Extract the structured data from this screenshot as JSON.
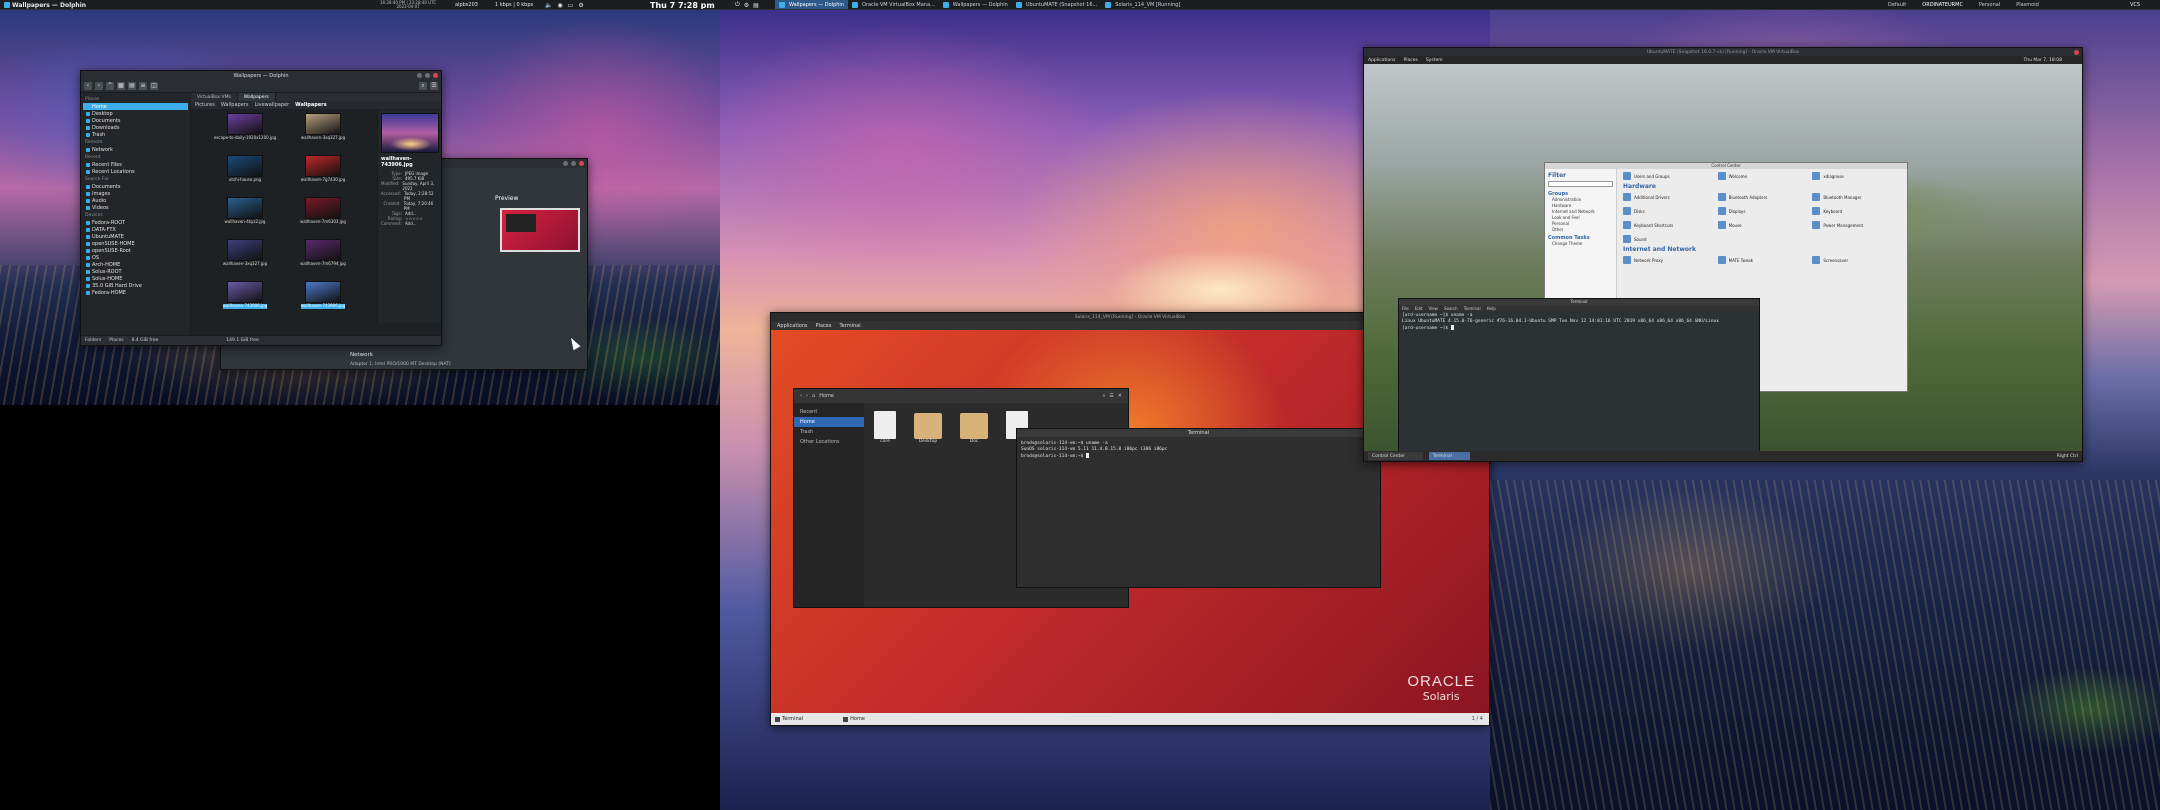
{
  "top_panel": {
    "left_title": "Wallpapers — Dolphin",
    "sys_stats_line1": "16:28:40 PM | 23:28:40 UTC",
    "sys_stats_line2": "2022-04-07",
    "net_stats": "1 kbps | 0 kbps",
    "username": "alpbs203",
    "clock": "Thu 7  7:28 pm",
    "tasks": [
      {
        "label": "Wallpapers — Dolphin",
        "active": true
      },
      {
        "label": "Oracle VM VirtualBox Mana...",
        "active": false
      },
      {
        "label": "Wallpapers — Dolphin",
        "active": false
      },
      {
        "label": "UbuntuMATE (Snapshot 16...",
        "active": false
      },
      {
        "label": "Solaris_114_VM [Running]",
        "active": false
      }
    ],
    "activities": [
      "Default",
      "ORDINATEURMC",
      "Personal",
      "Plasmoid"
    ],
    "active_activity": 1,
    "right_text": "VCS"
  },
  "dolphin": {
    "title": "Wallpapers — Dolphin",
    "tabs": [
      "VirtualBox VMs",
      "Wallpapers"
    ],
    "breadcrumbs": [
      "Pictures",
      "Wallpapers",
      "Livewallpaper",
      "Wallpapers"
    ],
    "places_heading": "Places",
    "places": [
      "Home",
      "Desktop",
      "Documents",
      "Downloads",
      "Trash"
    ],
    "remote_heading": "Remote",
    "remote": [
      "Network"
    ],
    "recent_heading": "Recent",
    "recent": [
      "Recent Files",
      "Recent Locations"
    ],
    "search_heading": "Search For",
    "search": [
      "Documents",
      "Images",
      "Audio",
      "Videos"
    ],
    "devices_heading": "Devices",
    "devices": [
      "Fedora-ROOT",
      "DATA-FTX",
      "UbuntuMATE",
      "openSUSE-HOME",
      "openSUSE-Root",
      "OS",
      "Arch-HOME",
      "Solus-ROOT",
      "Solus-HOME",
      "35.0 GiB Hard Drive",
      "Fedora-HOME"
    ],
    "files": [
      {
        "name": "escape-to-daily-1920x1200.jpg",
        "color": "#6b3fa0"
      },
      {
        "name": "wallhaven-3xq327.jpg",
        "color": "#b5a080"
      },
      {
        "name": "utshi-house.png",
        "color": "#1c4a7a"
      },
      {
        "name": "wallhaven-7g7430.jpg",
        "color": "#c0282a"
      },
      {
        "name": "wallhaven-4kyz2.jpg",
        "color": "#2b5f8e"
      },
      {
        "name": "wallhaven-7m6303.jpg",
        "color": "#7a1a2a"
      },
      {
        "name": "wallhaven-3xq327.jpg",
        "color": "#3e3e7e"
      },
      {
        "name": "wallhaven-7m6794.jpg",
        "color": "#5a2a6e"
      },
      {
        "name": "wallhaven-743906.jpg",
        "color": "#6a5aa8",
        "selected": true
      },
      {
        "name": "wallhaven-743906.jpg",
        "color": "#4a7ac8",
        "selected": true
      }
    ],
    "info": {
      "filename": "wallhaven-743906.jpg",
      "rows": [
        {
          "k": "Type:",
          "v": "JPEG image"
        },
        {
          "k": "Size:",
          "v": "495.7 KiB"
        },
        {
          "k": "Modified:",
          "v": "Sunday, April 3, 2022"
        },
        {
          "k": "Accessed:",
          "v": "Today, 2:28:52 PM"
        },
        {
          "k": "Created:",
          "v": "Today, 7:20:46 PM"
        },
        {
          "k": "Tags:",
          "v": "Add..."
        },
        {
          "k": "Rating:",
          "v": "☆☆☆☆☆"
        },
        {
          "k": "Comment:",
          "v": "Add..."
        }
      ]
    },
    "status": [
      "Folders",
      "Places"
    ],
    "status_free": "8.4 GiB free",
    "status_free2": "149.1 GiB free"
  },
  "vbox": {
    "preview_heading": "Preview",
    "network_heading": "Network",
    "adapter": "Adapter 1:   Intel PRO/1000 MT Desktop (NAT)"
  },
  "solaris": {
    "title": "Solaris_114_VM [Running] - Oracle VM VirtualBox",
    "menu": [
      "Applications",
      "Places",
      "Terminal"
    ],
    "nautilus_location": "Home",
    "nautilus_side": [
      "Recent",
      "Home",
      "Trash",
      "Other Locations"
    ],
    "nautilus_files": [
      {
        "name": "core",
        "kind": "doc"
      },
      {
        "name": "Desktop",
        "kind": "folder"
      },
      {
        "name": "Doc",
        "kind": "folder"
      },
      {
        "name": "",
        "kind": "doc"
      }
    ],
    "term_title": "Terminal",
    "term_lines": [
      "brods@solaris-114-vm:~$ uname -a",
      "SunOS solaris-114-vm 5.11 11.4.0.15.0 i86pc i386 i86pc",
      "brods@solaris-114-vm:~$ "
    ],
    "taskbar": [
      "Terminal",
      "Home"
    ],
    "counter": "1 / 4",
    "logo_line1": "ORACLE",
    "logo_line2": "Solaris"
  },
  "ubuntu": {
    "title": "UbuntuMATE (Snapshot 16.0.7-ck) [Running] - Oracle VM VirtualBox",
    "menu": [
      "Applications",
      "Places",
      "System"
    ],
    "clock": "Thu Mar 7, 18:08",
    "cc_title": "Control Center",
    "filter": "Filter",
    "groups_heading": "Groups",
    "groups": [
      "Administration",
      "Hardware",
      "Internet and Network",
      "Look and Feel",
      "Personal",
      "Other"
    ],
    "common_tasks": "Common Tasks",
    "tasks": [
      "Change Theme"
    ],
    "personal_items": [
      "Users and Groups",
      "Welcome",
      "xdiagnose"
    ],
    "hardware_heading": "Hardware",
    "hardware_items": [
      "Additional Drivers",
      "Bluetooth Adapters",
      "Bluetooth Manager",
      "Disks",
      "Displays",
      "Keyboard",
      "Keyboard Shortcuts",
      "Mouse",
      "Power Management",
      "Sound"
    ],
    "network_heading": "Internet and Network",
    "network_items": [
      "Network Proxy",
      "MATE Tweak",
      "Screensaver"
    ],
    "term_title": "Terminal",
    "term_menu": [
      "File",
      "Edit",
      "View",
      "Search",
      "Terminal",
      "Help"
    ],
    "term_lines": [
      "[ard-username ~]$ uname -a",
      "Linux UbuntuMATE 4.15.0-76-generic #76-16.04.1-Ubuntu SMP Tue Nov 12 14:01:16 UTC 2019 x86_64 x86_64 x86_64 GNU/Linux",
      "[ard-username ~]$ "
    ],
    "bottom_tasks": [
      "Control Center",
      "Terminal"
    ],
    "host_key": "Right Ctrl"
  }
}
